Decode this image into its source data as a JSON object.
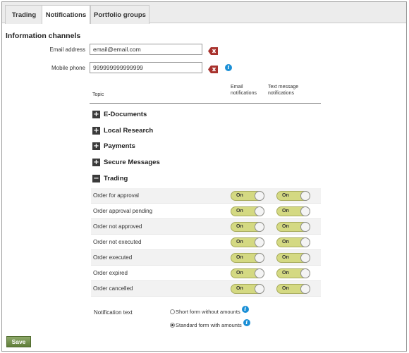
{
  "tabs": [
    {
      "label": "Trading",
      "active": false
    },
    {
      "label": "Notifications",
      "active": true
    },
    {
      "label": "Portfolio groups",
      "active": false
    }
  ],
  "section_title": "Information channels",
  "email": {
    "label": "Email address",
    "value": "email@email.com"
  },
  "mobile": {
    "label": "Mobile phone",
    "value": "999999999999999"
  },
  "table_header": {
    "topic": "Topic",
    "email_line1": "Email",
    "email_line2": "notifications",
    "sms_line1": "Text message",
    "sms_line2": "notifications"
  },
  "categories": [
    {
      "label": "E-Documents",
      "expanded": false
    },
    {
      "label": "Local Research",
      "expanded": false
    },
    {
      "label": "Payments",
      "expanded": false
    },
    {
      "label": "Secure Messages",
      "expanded": false
    },
    {
      "label": "Trading",
      "expanded": true
    }
  ],
  "trading_rows": [
    {
      "label": "Order for approval",
      "email": "On",
      "sms": "On"
    },
    {
      "label": "Order approval pending",
      "email": "On",
      "sms": "On"
    },
    {
      "label": "Order not approved",
      "email": "On",
      "sms": "On"
    },
    {
      "label": "Order not executed",
      "email": "On",
      "sms": "On"
    },
    {
      "label": "Order executed",
      "email": "On",
      "sms": "On"
    },
    {
      "label": "Order expired",
      "email": "On",
      "sms": "On"
    },
    {
      "label": "Order cancelled",
      "email": "On",
      "sms": "On"
    }
  ],
  "notification_text": {
    "label": "Notification text",
    "options": [
      {
        "label": "Short form without amounts",
        "selected": false
      },
      {
        "label": "Standard form with amounts",
        "selected": true
      }
    ]
  },
  "save_label": "Save",
  "colors": {
    "toggle_on": "#d4d982",
    "save_button": "#6f8c45",
    "info": "#1a8fd6",
    "clear_icon": "#a8322d"
  }
}
